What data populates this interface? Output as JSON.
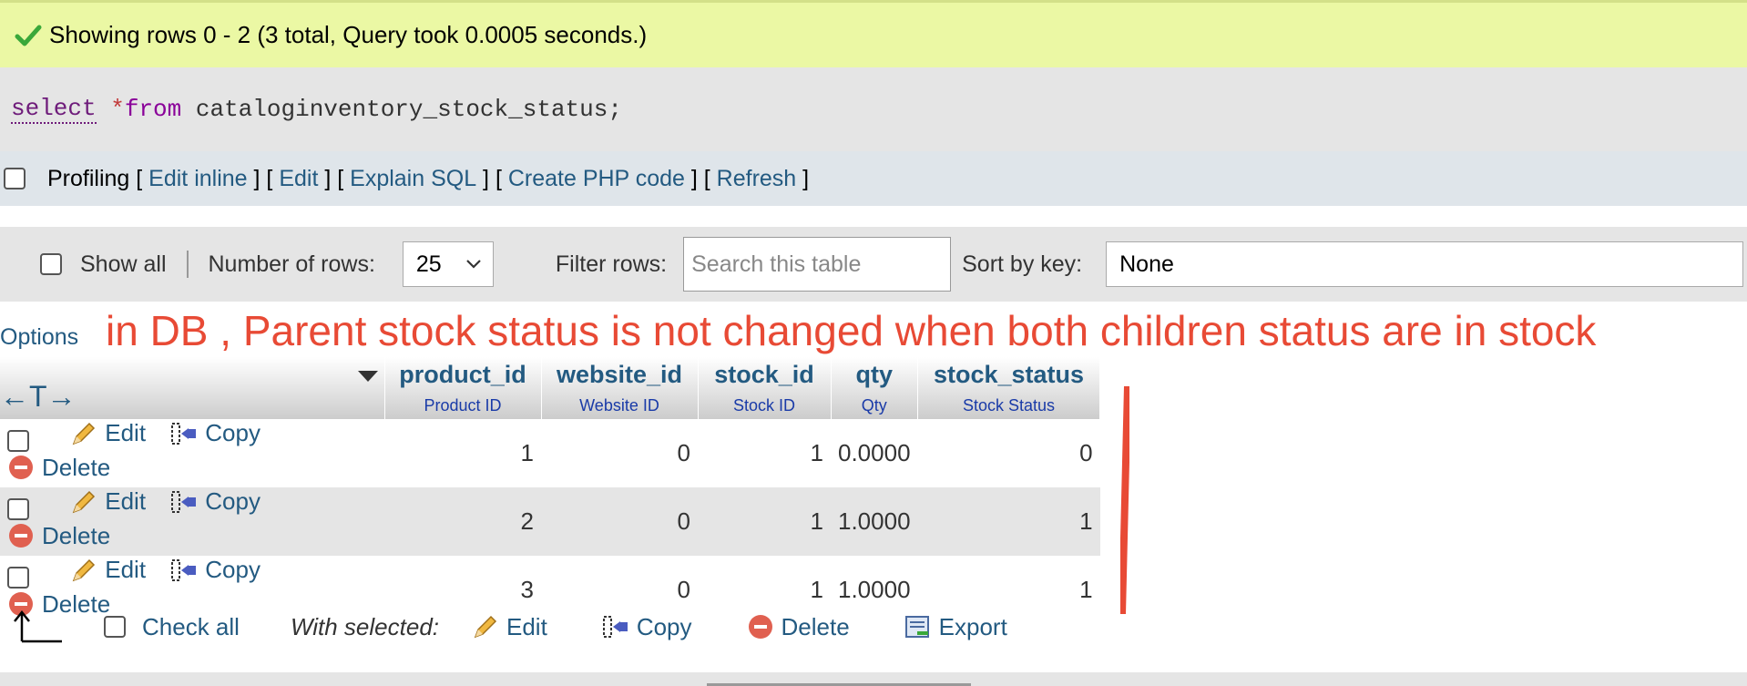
{
  "status": {
    "message": "Showing rows 0 - 2 (3 total, Query took 0.0005 seconds.)"
  },
  "sql": {
    "kw_select": "select",
    "kw_star": "*",
    "kw_from": "from",
    "rest": "cataloginventory_stock_status;"
  },
  "profiling": {
    "label": "Profiling",
    "links": [
      "Edit inline",
      "Edit",
      "Explain SQL",
      "Create PHP code",
      "Refresh"
    ]
  },
  "nav": {
    "show_all_label": "Show all",
    "rows_label": "Number of rows:",
    "rows_value": "25",
    "filter_label": "Filter rows:",
    "search_placeholder": "Search this table",
    "sort_label": "Sort by key:",
    "sort_value": "None"
  },
  "options_label": "Options",
  "annotation": "in DB , Parent stock status is not changed when both children status are in stock",
  "table": {
    "resize_glyph": "←T→",
    "columns": [
      {
        "name": "product_id",
        "comment": "Product ID"
      },
      {
        "name": "website_id",
        "comment": "Website ID"
      },
      {
        "name": "stock_id",
        "comment": "Stock ID"
      },
      {
        "name": "qty",
        "comment": "Qty"
      },
      {
        "name": "stock_status",
        "comment": "Stock Status"
      }
    ],
    "actions": {
      "edit": "Edit",
      "copy": "Copy",
      "delete": "Delete"
    },
    "rows": [
      {
        "product_id": "1",
        "website_id": "0",
        "stock_id": "1",
        "qty": "0.0000",
        "stock_status": "0"
      },
      {
        "product_id": "2",
        "website_id": "0",
        "stock_id": "1",
        "qty": "1.0000",
        "stock_status": "1"
      },
      {
        "product_id": "3",
        "website_id": "0",
        "stock_id": "1",
        "qty": "1.0000",
        "stock_status": "1"
      }
    ]
  },
  "bottom": {
    "check_all": "Check all",
    "with_selected": "With selected:",
    "edit": "Edit",
    "copy": "Copy",
    "delete": "Delete",
    "export": "Export"
  },
  "colors": {
    "success_bg": "#ebf8a4",
    "link": "#235a81",
    "annotation": "#e84a35"
  }
}
